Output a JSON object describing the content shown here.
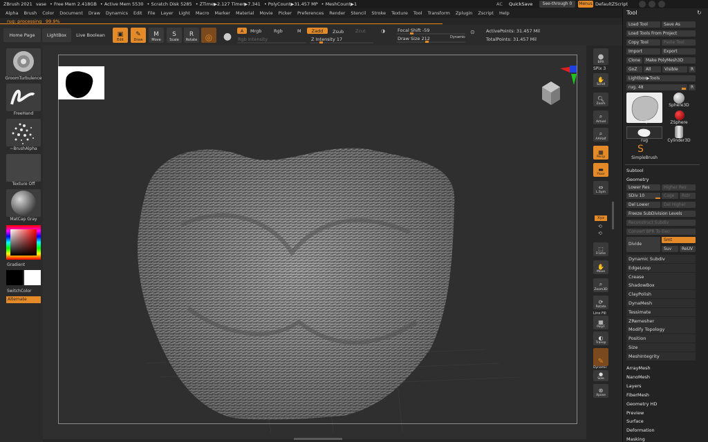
{
  "status": {
    "app": "ZBrush 2021",
    "doc": "vase",
    "free_mem": "• Free Mem 2.418GB",
    "active_mem": "• Active Mem 5530",
    "scratch": "• Scratch Disk 5285",
    "ztime": "• ZTime▶2.127 Timer▶7.341",
    "polycount": "• PolyCount▶31.457 MP",
    "meshcount": "• MeshCount▶1",
    "ac": "AC",
    "quicksave": "QuickSave",
    "seethrough": "See-through 0",
    "menus": "Menus",
    "script": "DefaultZScript"
  },
  "menu": [
    "Alpha",
    "Brush",
    "Color",
    "Document",
    "Draw",
    "Dynamics",
    "Edit",
    "File",
    "Layer",
    "Light",
    "Macro",
    "Marker",
    "Material",
    "Movie",
    "Picker",
    "Preferences",
    "Render",
    "Stencil",
    "Stroke",
    "Texture",
    "Tool",
    "Transform",
    "Zplugin",
    "Zscript",
    "Help"
  ],
  "progress": {
    "label": "rug: processing",
    "percent": "99.9%"
  },
  "toolbar": {
    "home": "Home Page",
    "lightbox": "LightBox",
    "liveboolean": "Live Boolean",
    "edit": "Edit",
    "draw": "Draw",
    "move": "Move",
    "scale": "Scale",
    "rotate": "Rotate",
    "a": "A",
    "mrgb": "Mrgb",
    "rgb": "Rgb",
    "m": "M",
    "zadd": "Zadd",
    "zsub": "Zsub",
    "zcut": "Zcut",
    "rgb_intensity": "Rgb Intensity",
    "z_intensity": "Z Intensity 17",
    "focal_shift": "Focal Shift -59",
    "draw_size": "Draw Size 212",
    "dynamic": "Dynamic",
    "active_points": "ActivePoints: 31.457 Mil",
    "total_points": "TotalPoints: 31.457 Mil"
  },
  "leftshelf": {
    "brush": "GroomTurbulence",
    "stroke": "FreeHand",
    "alpha": "~BrushAlpha",
    "texture": "Texture Off",
    "material": "MatCap Gray",
    "gradient": "Gradient",
    "switchcolor": "SwitchColor",
    "alternate": "Alternate"
  },
  "rightshelf": {
    "bpr": "BPR",
    "spix": "SPix 3",
    "scroll": "Scroll",
    "zoom": "Zoom",
    "actual": "Actual",
    "aahalf": "AAHalf",
    "persp": "Persp",
    "floor": "Floor",
    "lsym": "L.Sym",
    "xyz": "Xyz",
    "frame": "Frame",
    "move": "Move",
    "zoom3d": "Zoom3D",
    "rotate": "Rotate",
    "linefill": "Line Fill",
    "polyf": "PolyF",
    "transp": "Transp",
    "dynamic": "Dynamic",
    "solo": "Solo",
    "xpose": "Xpose"
  },
  "toolpanel": {
    "title": "Tool",
    "load_tool": "Load Tool",
    "save_as": "Save As",
    "load_from_project": "Load Tools From Project",
    "copy_tool": "Copy Tool",
    "paste_tool": "Paste Tool",
    "import": "Import",
    "export": "Export",
    "clone": "Clone",
    "make_polymesh": "Make PolyMesh3D",
    "goz": "GoZ",
    "all": "All",
    "visible": "Visible",
    "r": "R",
    "lightbox_tools": "Lightbox▶Tools",
    "rug_slider": "rug. 48",
    "r2": "R",
    "tools": [
      "rug",
      "Sphere3D",
      "ZSphere",
      "rug",
      "Cylinder3D",
      "SimpleBrush"
    ],
    "subtool": "Subtool",
    "geometry": "Geometry",
    "lower_res": "Lower Res",
    "higher_res": "Higher Res",
    "sdiv": "SDiv 10",
    "cage": "Cage",
    "rstr": "Rstr",
    "del_lower": "Del Lower",
    "del_higher": "Del Higher",
    "freeze": "Freeze SubDivision Levels",
    "reconstruct": "Reconstruct Subdiv",
    "convert_bpr": "Convert BPR To Geo",
    "divide": "Divide",
    "smt": "Smt",
    "suv": "Suv",
    "reuv": "ReUV",
    "geom_items": [
      "Dynamic Subdiv",
      "EdgeLoop",
      "Crease",
      "ShadowBox",
      "ClayPolish",
      "DynaMesh",
      "Tessimate",
      "ZRemesher",
      "Modify Topology",
      "Position",
      "Size",
      "MeshIntegrity"
    ],
    "sections": [
      "ArrayMesh",
      "NanoMesh",
      "Layers",
      "FiberMesh",
      "Geometry HD",
      "Preview",
      "Surface",
      "Deformation",
      "Masking"
    ]
  },
  "colors": {
    "accent": "#e58a28",
    "bg": "#262626"
  }
}
